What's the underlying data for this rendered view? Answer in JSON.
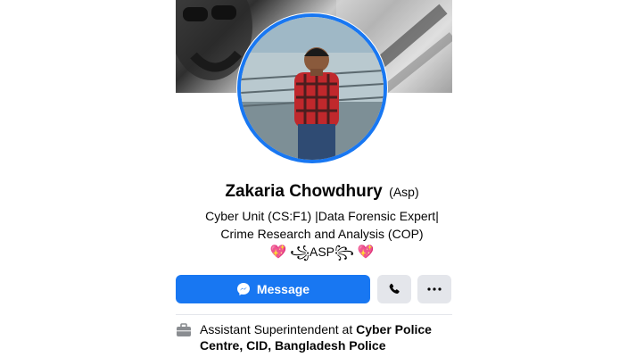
{
  "profile": {
    "name": "Zakaria Chowdhury",
    "name_suffix": "(Asp)",
    "bio_line1": "Cyber Unit (CS:F1) |Data Forensic Expert|",
    "bio_line2": "Crime Research and Analysis (COP)",
    "bio_line3_heart_left": "💖",
    "bio_line3_text": " ꧁ASP꧂ ",
    "bio_line3_heart_right": "💖"
  },
  "actions": {
    "message_label": "Message"
  },
  "work": {
    "prefix": "Assistant Superintendent at ",
    "org": "Cyber Police Centre, CID, Bangladesh Police"
  },
  "icons": {
    "messenger": "messenger-icon",
    "phone": "phone-icon",
    "more": "more-dots-icon",
    "briefcase": "briefcase-icon"
  },
  "colors": {
    "accent": "#1877f2",
    "secondary_button": "#e4e6eb",
    "text": "#050505"
  }
}
